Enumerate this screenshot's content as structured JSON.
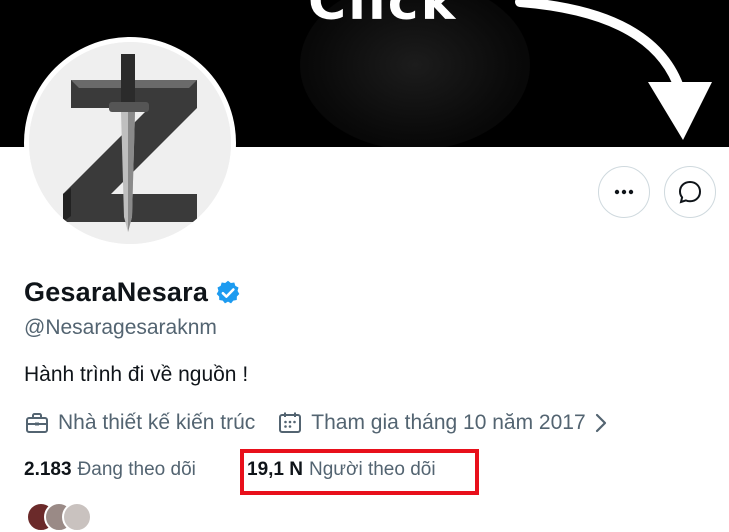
{
  "banner": {
    "text": "Click"
  },
  "profile": {
    "display_name": "GesaraNesara",
    "handle": "@Nesaragesaraknm",
    "bio": "Hành trình đi về nguồn !",
    "profession": "Nhà thiết kế kiến trúc",
    "joined": "Tham gia tháng 10 năm 2017"
  },
  "stats": {
    "following_count": "2.183",
    "following_label": "Đang theo dõi",
    "followers_count": "19,1 N",
    "followers_label": "Người theo dõi"
  },
  "icons": {
    "more": "more-horizontal-icon",
    "message": "message-bubble-icon",
    "verified": "verified-badge-icon",
    "profession": "briefcase-icon",
    "joined": "calendar-icon",
    "chevron": "chevron-right-icon"
  },
  "colors": {
    "verified_blue": "#1d9bf0",
    "highlight_red": "#e8101b",
    "secondary_text": "#536471",
    "primary_text": "#0f1419"
  }
}
